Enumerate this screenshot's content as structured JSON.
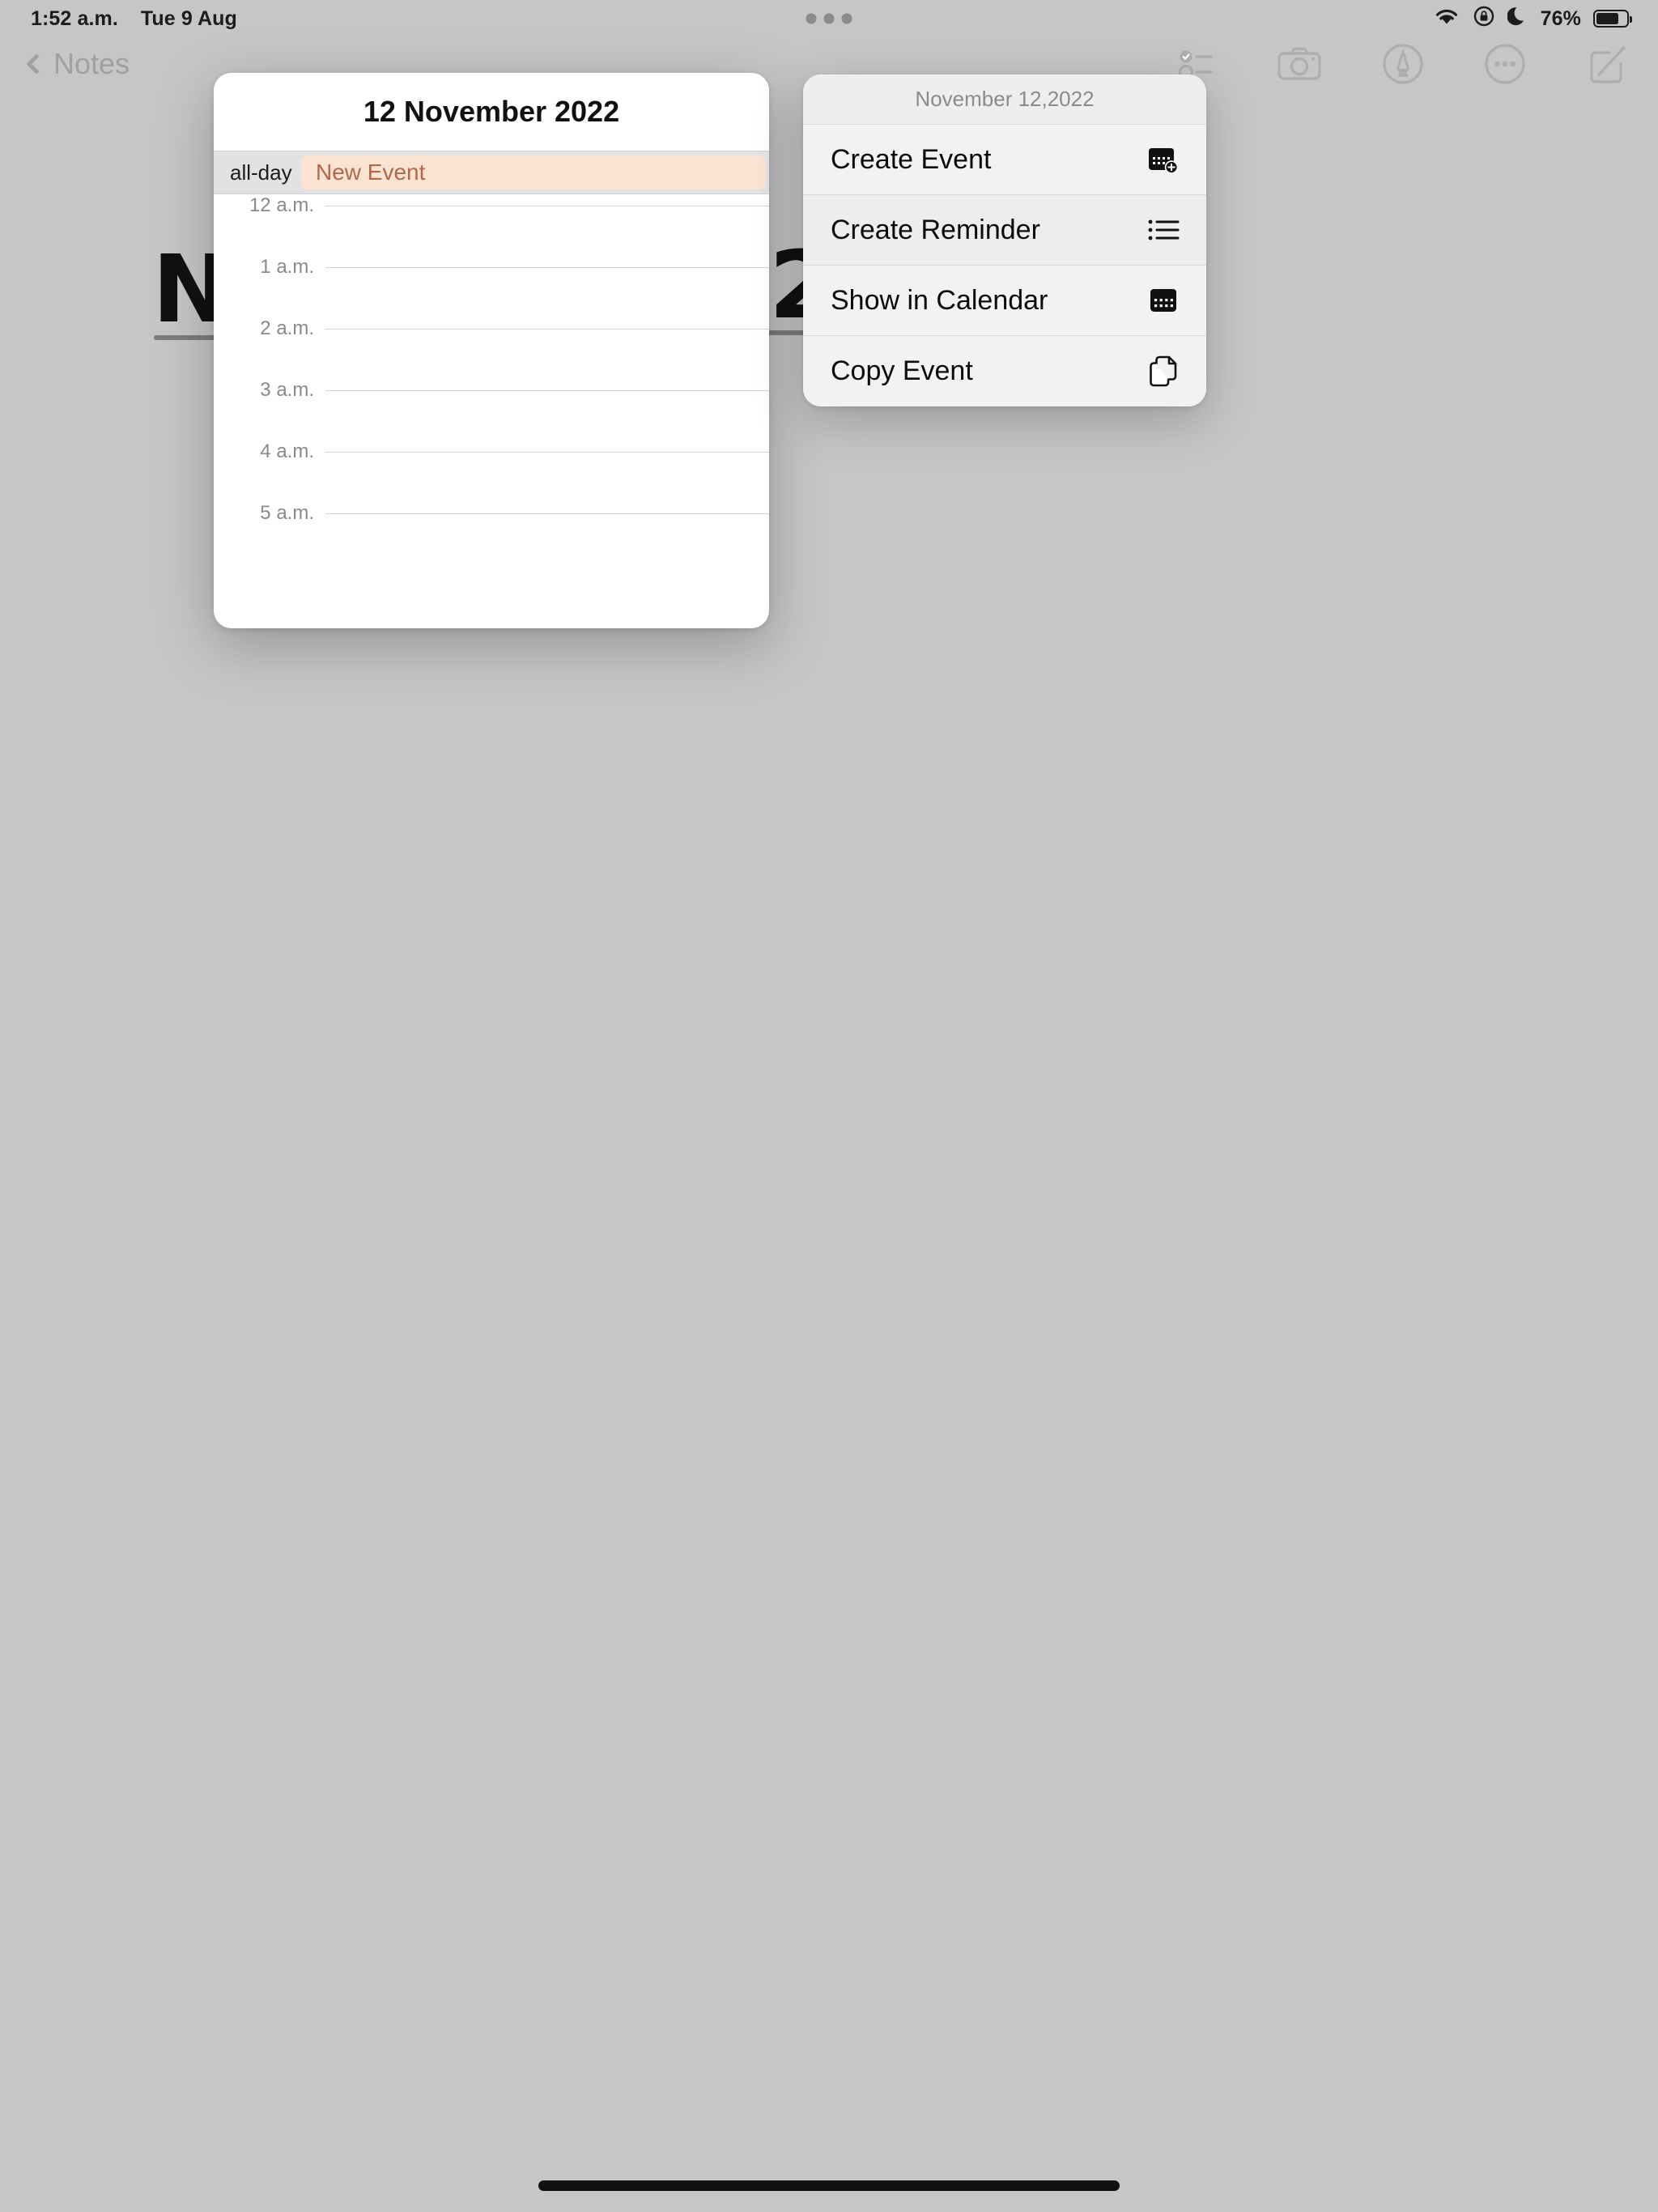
{
  "status_bar": {
    "time": "1:52 a.m.",
    "date": "Tue 9 Aug",
    "battery_percent": "76%",
    "icons": [
      "wifi-icon",
      "rotation-lock-icon",
      "do-not-disturb-moon-icon",
      "battery-icon"
    ]
  },
  "navbar": {
    "back_label": "Notes",
    "back_icon": "chevron-left-icon",
    "tools": [
      {
        "name": "checklist-icon",
        "label": "Checklist"
      },
      {
        "name": "camera-icon",
        "label": "Camera"
      },
      {
        "name": "markup-pen-icon",
        "label": "Markup"
      },
      {
        "name": "more-ellipsis-icon",
        "label": "More"
      },
      {
        "name": "compose-icon",
        "label": "Compose"
      }
    ]
  },
  "note": {
    "handwriting_left": "N",
    "handwriting_right": "2"
  },
  "calendar_popover": {
    "title": "12 November 2022",
    "all_day_label": "all-day",
    "all_day_event": "New Event",
    "hours": [
      "12 a.m.",
      "1 a.m.",
      "2 a.m.",
      "3 a.m.",
      "4 a.m.",
      "5 a.m."
    ]
  },
  "context_menu": {
    "header": "November 12,2022",
    "items": [
      {
        "label": "Create Event",
        "icon": "calendar-plus-icon"
      },
      {
        "label": "Create Reminder",
        "icon": "bulleted-list-icon"
      },
      {
        "label": "Show in Calendar",
        "icon": "calendar-icon"
      },
      {
        "label": "Copy Event",
        "icon": "copy-document-icon"
      }
    ]
  },
  "colors": {
    "backdrop": "#c6c6c6",
    "event_pill_bg": "#fbe3d4",
    "event_pill_text": "#b0674a",
    "menu_bg": "#f1f1f1"
  }
}
